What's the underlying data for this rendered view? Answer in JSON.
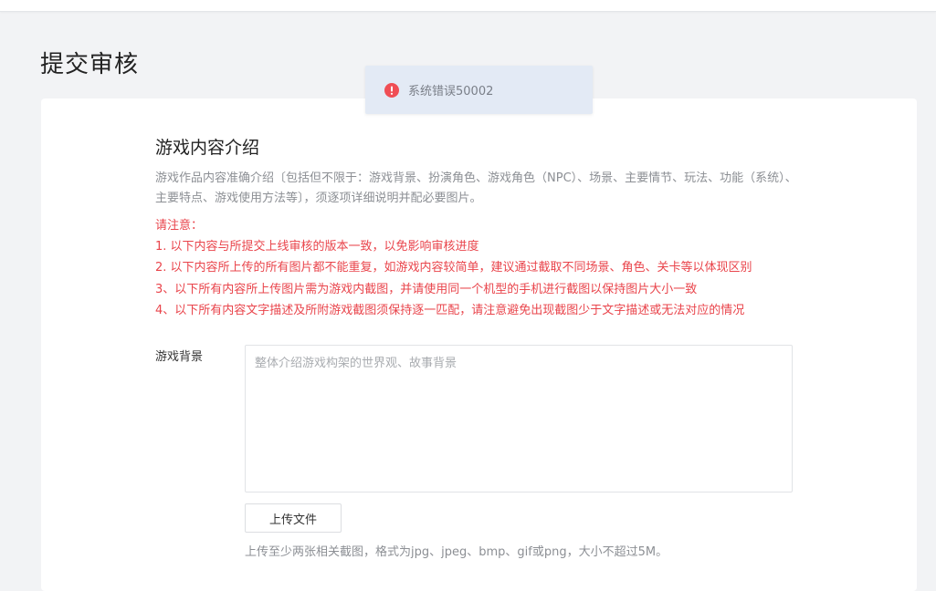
{
  "page": {
    "title": "提交审核"
  },
  "toast": {
    "icon": "error-icon",
    "message": "系统错误50002",
    "color": "#f04e55"
  },
  "intro": {
    "title": "游戏内容介绍",
    "description": "游戏作品内容准确介绍〔包括但不限于：游戏背景、扮演角色、游戏角色（NPC）、场景、主要情节、玩法、功能（系统）、主要特点、游戏使用方法等〕，须逐项详细说明并配必要图片。"
  },
  "notice": {
    "heading": "请注意：",
    "items": [
      "1. 以下内容与所提交上线审核的版本一致，以免影响审核进度",
      "2. 以下内容所上传的所有图片都不能重复，如游戏内容较简单，建议通过截取不同场景、角色、关卡等以体现区别",
      "3、以下所有内容所上传图片需为游戏内截图，并请使用同一个机型的手机进行截图以保持图片大小一致",
      "4、以下所有内容文字描述及所附游戏截图须保持逐一匹配，请注意避免出现截图少于文字描述或无法对应的情况"
    ],
    "color": "#e9444b"
  },
  "background_field": {
    "label": "游戏背景",
    "value": "",
    "placeholder": "整体介绍游戏构架的世界观、故事背景",
    "upload_label": "上传文件",
    "hint": "上传至少两张相关截图，格式为jpg、jpeg、bmp、gif或png，大小不超过5M。"
  }
}
